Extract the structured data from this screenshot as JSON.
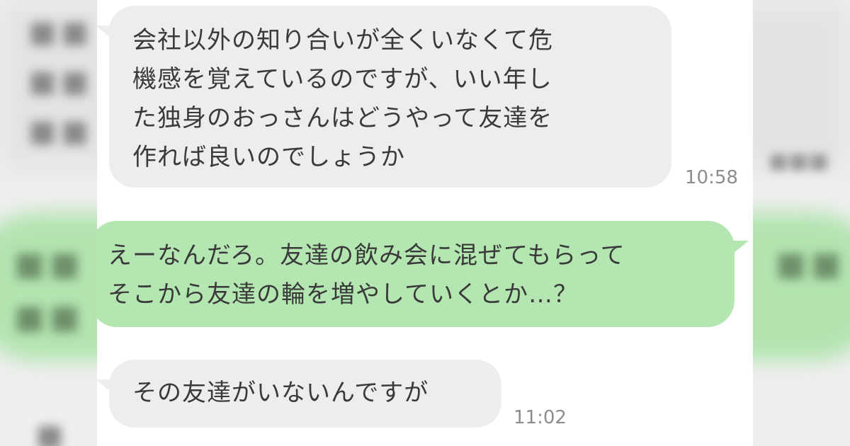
{
  "chat": {
    "messages": [
      {
        "side": "incoming",
        "lines": [
          "会社以外の知り合いが全くいなくて危",
          "機感を覚えているのですが、いい年し",
          "た独身のおっさんはどうやって友達を",
          "作れば良いのでしょうか"
        ],
        "time": "10:58"
      },
      {
        "side": "outgoing",
        "lines": [
          "えーなんだろ。友達の飲み会に混ぜてもらって",
          "そこから友達の輪を増やしていくとか…？"
        ],
        "time": ""
      },
      {
        "side": "incoming",
        "lines": [
          "その友達がいないんですが"
        ],
        "time": "11:02"
      }
    ]
  },
  "colors": {
    "incoming_bubble": "#ededef",
    "outgoing_bubble": "#b4e6b2",
    "text": "#3a3a3a",
    "timestamp": "#8d8d8d",
    "panel_background": "#ffffff"
  }
}
